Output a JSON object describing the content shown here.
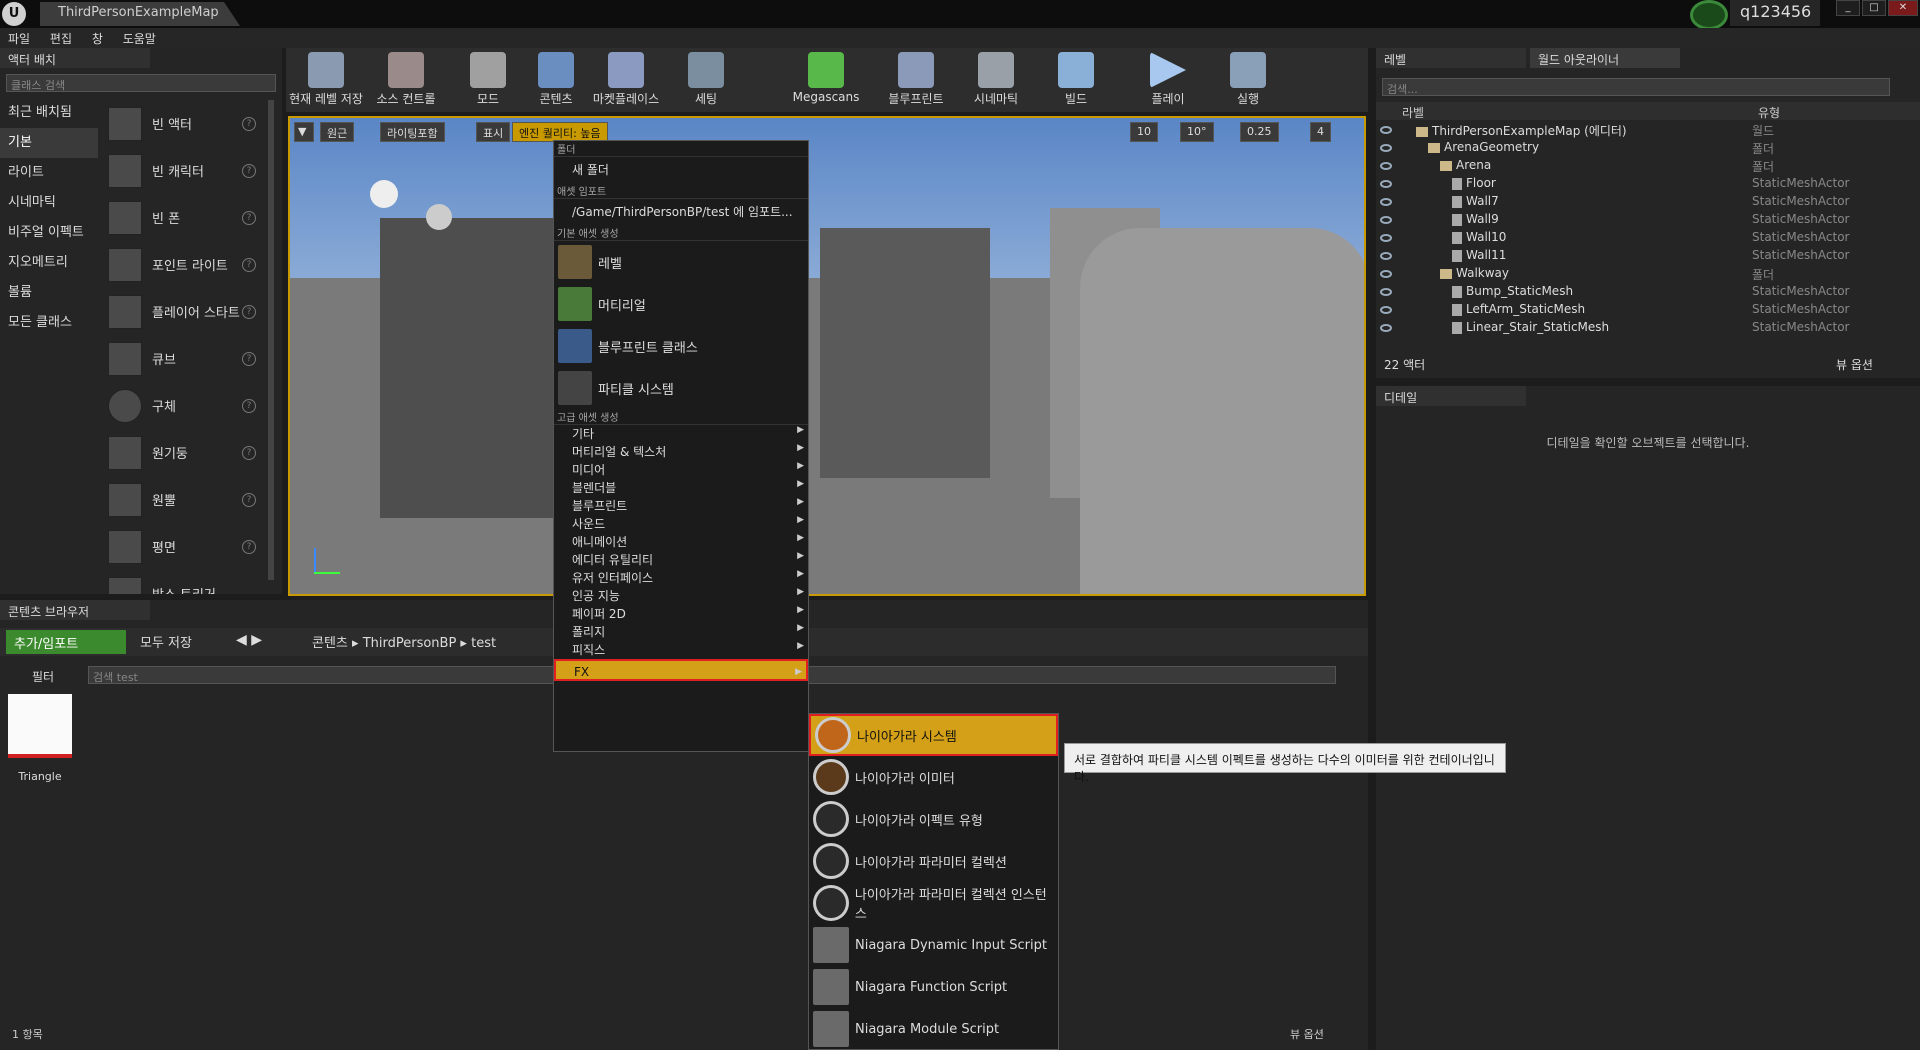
{
  "window": {
    "logo": "U",
    "tab_title": "ThirdPersonExampleMap",
    "user": "q123456",
    "controls": [
      "_",
      "□",
      "✕"
    ]
  },
  "menu": [
    "파일",
    "편집",
    "창",
    "도움말"
  ],
  "place_actors": {
    "tab_label": "액터 배치",
    "search_placeholder": "클래스 검색",
    "categories": [
      "최근 배치됨",
      "기본",
      "라이트",
      "시네마틱",
      "비주얼 이펙트",
      "지오메트리",
      "볼륨",
      "모든 클래스"
    ],
    "selected_category": "기본",
    "items": [
      "빈 액터",
      "빈 캐릭터",
      "빈 폰",
      "포인트 라이트",
      "플레이어 스타트",
      "큐브",
      "구체",
      "원기둥",
      "원뿔",
      "평면",
      "박스 트리거"
    ]
  },
  "toolbar": {
    "buttons": [
      "현재 레벨 저장",
      "소스 컨트롤",
      "모드",
      "콘텐츠",
      "마켓플레이스",
      "세팅",
      "Megascans",
      "블루프린트",
      "시네마틱",
      "빌드",
      "플레이",
      "실행"
    ]
  },
  "viewport": {
    "buttons": [
      "원근",
      "라이팅포함",
      "표시",
      "엔진 퀄리티: 높음"
    ],
    "snap_values": [
      "10",
      "10°",
      "0.25",
      "4"
    ]
  },
  "context_menu": {
    "section_folder": "폴더",
    "new_folder": "새 폴더",
    "section_import": "애셋 임포트",
    "import_item": "/Game/ThirdPersonBP/test 에 임포트...",
    "section_basic": "기본 애셋 생성",
    "basic_items": [
      "레벨",
      "머티리얼",
      "블루프린트 클래스",
      "파티클 시스템"
    ],
    "section_advanced": "고급 애셋 생성",
    "advanced_items": [
      "기타",
      "머티리얼 & 텍스처",
      "미디어",
      "블렌더블",
      "블루프린트",
      "사운드",
      "애니메이션",
      "에디터 유틸리티",
      "유저 인터페이스",
      "인공 지능",
      "페이퍼 2D",
      "폴리지",
      "피직스",
      "FX"
    ]
  },
  "fx_submenu": {
    "items": [
      "나이아가라 시스템",
      "나이아가라 이미터",
      "나이아가라 이펙트 유형",
      "나이아가라 파라미터 컬렉션",
      "나이아가라 파라미터 컬렉션 인스턴스",
      "Niagara Dynamic Input Script",
      "Niagara Function Script",
      "Niagara Module Script"
    ],
    "tooltip": "서로 결합하여 파티클 시스템 이펙트를 생성하는 다수의 이미터를 위한 컨테이너입니다."
  },
  "world_outliner": {
    "tab_level": "레벨",
    "tab_outliner": "월드 아웃라이너",
    "search_placeholder": "검색...",
    "col_label": "라벨",
    "col_type": "유형",
    "rows": [
      {
        "label": "ThirdPersonExampleMap (에디터)",
        "type": "월드"
      },
      {
        "label": "ArenaGeometry",
        "type": "폴더"
      },
      {
        "label": "Arena",
        "type": "폴더"
      },
      {
        "label": "Floor",
        "type": "StaticMeshActor"
      },
      {
        "label": "Wall7",
        "type": "StaticMeshActor"
      },
      {
        "label": "Wall9",
        "type": "StaticMeshActor"
      },
      {
        "label": "Wall10",
        "type": "StaticMeshActor"
      },
      {
        "label": "Wall11",
        "type": "StaticMeshActor"
      },
      {
        "label": "Walkway",
        "type": "폴더"
      },
      {
        "label": "Bump_StaticMesh",
        "type": "StaticMeshActor"
      },
      {
        "label": "LeftArm_StaticMesh",
        "type": "StaticMeshActor"
      },
      {
        "label": "Linear_Stair_StaticMesh",
        "type": "StaticMeshActor"
      }
    ],
    "actor_count": "22 액터",
    "view_options": "뷰 옵션"
  },
  "details": {
    "tab_label": "디테일",
    "empty_text": "디테일을 확인할 오브젝트를 선택합니다."
  },
  "content_browser": {
    "tab_label": "콘텐츠 브라우저",
    "add_import": "추가/임포트",
    "save_all": "모두 저장",
    "breadcrumb": [
      "콘텐츠",
      "ThirdPersonBP",
      "test"
    ],
    "filter": "필터",
    "search_placeholder": "검색 test",
    "asset_name": "Triangle",
    "item_count": "1 항목",
    "view_options": "뷰 옵션"
  },
  "colors": {
    "highlight": "#d4a017",
    "selection_border": "#e02020",
    "accent_green": "#3c8a2e"
  }
}
